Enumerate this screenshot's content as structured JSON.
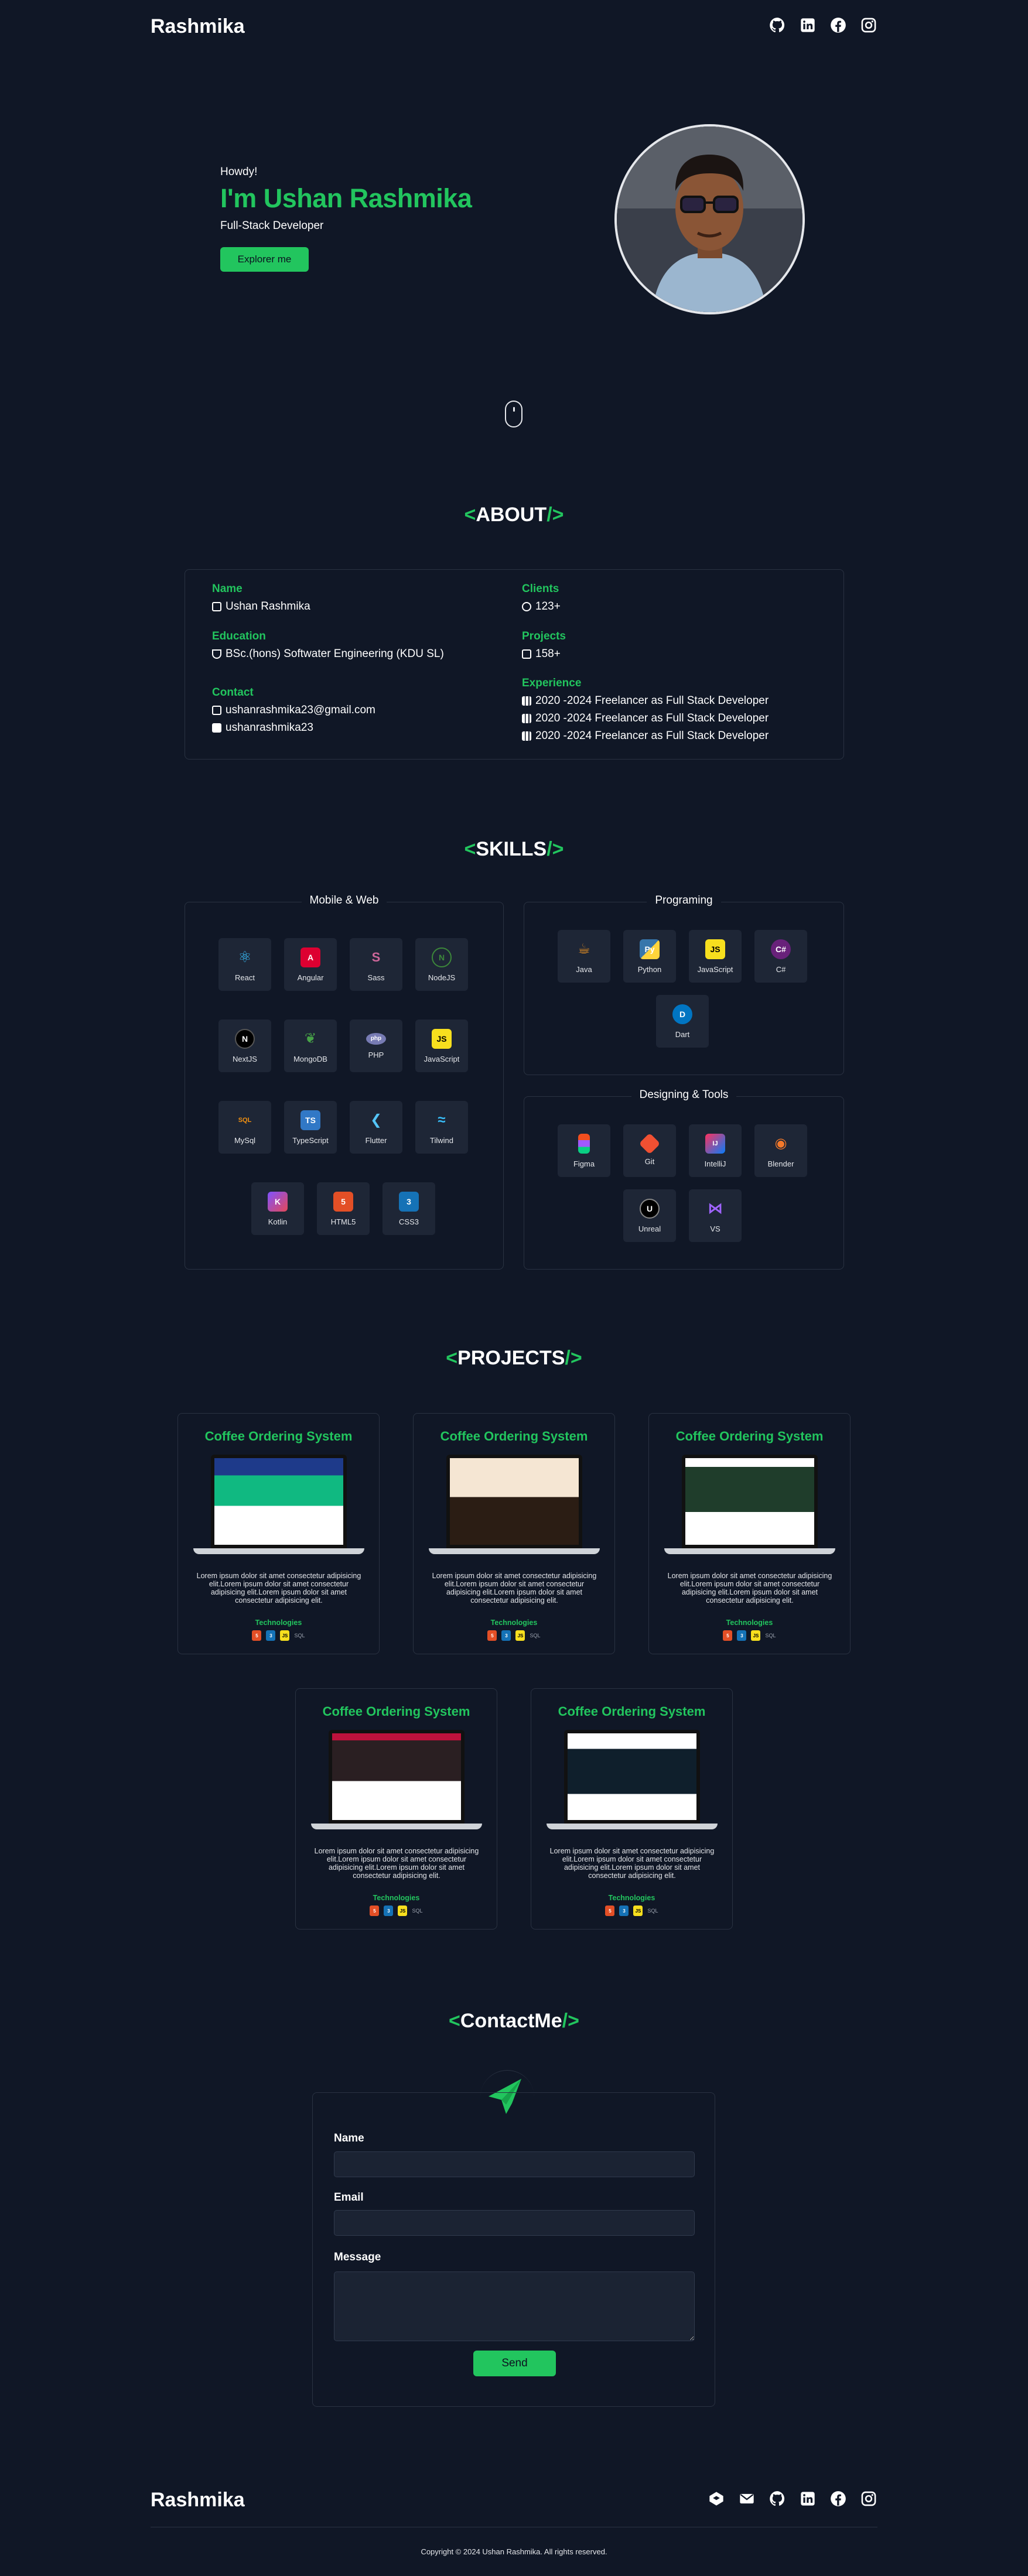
{
  "nav": {
    "brand": "Rashmika",
    "icons": [
      "github-icon",
      "linkedin-icon",
      "facebook-icon",
      "instagram-icon"
    ]
  },
  "hero": {
    "greeting": "Howdy!",
    "name": "I'm Ushan Rashmika",
    "role": "Full-Stack Developer",
    "button": "Explorer me"
  },
  "about": {
    "title_open": "<",
    "title": "ABOUT",
    "title_close": "/>",
    "name_label": "Name",
    "name_value": "Ushan Rashmika",
    "education_label": "Education",
    "education_value": "BSc.(hons) Softwater Engineering (KDU SL)",
    "contact_label": "Contact",
    "email": "ushanrashmika23@gmail.com",
    "linkedin": "ushanrashmika23",
    "clients_label": "Clients",
    "clients_value": "123+",
    "projects_label": "Projects",
    "projects_value": "158+",
    "experience_label": "Experience",
    "experience": [
      "2020 -2024 Freelancer as Full Stack Developer",
      "2020 -2024 Freelancer as Full Stack Developer",
      "2020 -2024 Freelancer as Full Stack Developer"
    ]
  },
  "skills": {
    "title_open": "<",
    "title": "SKILLS",
    "title_close": "/>",
    "mobile_web_title": "Mobile & Web",
    "mobile_web": [
      "React",
      "Angular",
      "Sass",
      "NodeJS",
      "NextJS",
      "MongoDB",
      "PHP",
      "JavaScript",
      "MySql",
      "TypeScript",
      "Flutter",
      "Tilwind",
      "Kotlin",
      "HTML5",
      "CSS3"
    ],
    "programing_title": "Programing",
    "programing": [
      "Java",
      "Python",
      "JavaScript",
      "C#",
      "Dart"
    ],
    "designing_title": "Designing & Tools",
    "designing": [
      "Figma",
      "Git",
      "IntelliJ",
      "Blender",
      "Unreal",
      "VS"
    ]
  },
  "projects": {
    "title_open": "<",
    "title": "PROJECTS",
    "title_close": "/>",
    "items": [
      {
        "title": "Coffee Ordering System",
        "desc": "Lorem ipsum dolor sit amet consectetur adipisicing elit.Lorem ipsum dolor sit amet consectetur adipisicing elit.Lorem ipsum dolor sit amet consectetur adipisicing elit.",
        "tech_label": "Technologies"
      },
      {
        "title": "Coffee Ordering System",
        "desc": "Lorem ipsum dolor sit amet consectetur adipisicing elit.Lorem ipsum dolor sit amet consectetur adipisicing elit.Lorem ipsum dolor sit amet consectetur adipisicing elit.",
        "tech_label": "Technologies"
      },
      {
        "title": "Coffee Ordering System",
        "desc": "Lorem ipsum dolor sit amet consectetur adipisicing elit.Lorem ipsum dolor sit amet consectetur adipisicing elit.Lorem ipsum dolor sit amet consectetur adipisicing elit.",
        "tech_label": "Technologies"
      },
      {
        "title": "Coffee Ordering System",
        "desc": "Lorem ipsum dolor sit amet consectetur adipisicing elit.Lorem ipsum dolor sit amet consectetur adipisicing elit.Lorem ipsum dolor sit amet consectetur adipisicing elit.",
        "tech_label": "Technologies"
      },
      {
        "title": "Coffee Ordering System",
        "desc": "Lorem ipsum dolor sit amet consectetur adipisicing elit.Lorem ipsum dolor sit amet consectetur adipisicing elit.Lorem ipsum dolor sit amet consectetur adipisicing elit.",
        "tech_label": "Technologies"
      }
    ]
  },
  "contact": {
    "title_open": "<",
    "title": "ContactMe",
    "title_close": "/>",
    "name_label": "Name",
    "email_label": "Email",
    "message_label": "Message",
    "send": "Send"
  },
  "footer": {
    "brand": "Rashmika",
    "icons": [
      "codepen-icon",
      "mail-icon",
      "github-icon",
      "linkedin-icon",
      "facebook-icon",
      "instagram-icon"
    ],
    "copyright": "Copyright © 2024 Ushan Rashmika. All rights reserved."
  },
  "colors": {
    "background": "#101726",
    "accent": "#22c55e",
    "card_border": "#2a3242"
  }
}
